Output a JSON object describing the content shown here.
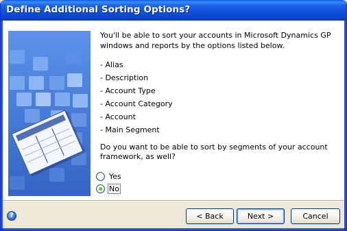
{
  "window": {
    "title": "Define Additional Sorting Options?"
  },
  "content": {
    "intro": "You'll be able to sort your accounts in Microsoft Dynamics GP windows and reports by the options listed below.",
    "options_list": [
      "- Alias",
      "- Description",
      "- Account Type",
      "- Account Category",
      "- Account",
      "- Main Segment"
    ],
    "question": "Do you want to be able to sort by segments of your account framework, as well?"
  },
  "radios": {
    "yes_label": "Yes",
    "no_label": "No",
    "selected": "No"
  },
  "buttons": {
    "back": "< Back",
    "next": "Next >",
    "cancel": "Cancel"
  },
  "icons": {
    "help": "help-icon",
    "side_image": "spreadsheet-illustration"
  },
  "colors": {
    "titlebar": "#0a4fdb",
    "side_panel": "#4479d8",
    "radio_selected": "#2d9b1d"
  }
}
